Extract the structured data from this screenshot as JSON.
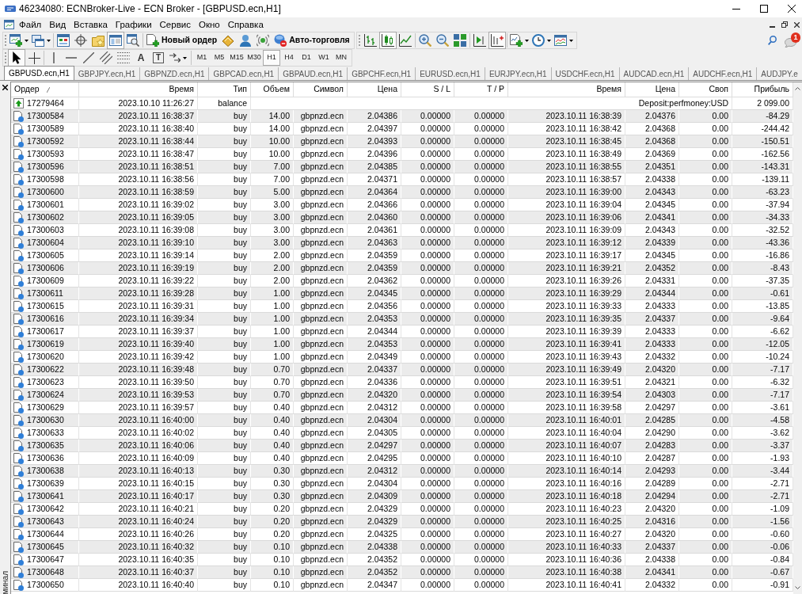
{
  "window": {
    "title": "46234080: ECNBroker-Live - ECN Broker - [GBPUSD.ecn,H1]"
  },
  "menu": [
    "Файл",
    "Вид",
    "Вставка",
    "Графики",
    "Сервис",
    "Окно",
    "Справка"
  ],
  "main_toolbar": [
    [
      [
        {
          "kind": "menu",
          "pressed": false
        },
        {
          "kind": "menu",
          "pressed": false
        }
      ],
      [
        {
          "kind": "icon",
          "pressed": false
        },
        {
          "kind": "icon",
          "pressed": false
        },
        {
          "kind": "icon",
          "pressed": false
        },
        {
          "kind": "icon",
          "pressed": true
        },
        {
          "kind": "icon",
          "pressed": false
        }
      ],
      [
        {
          "kind": "labeled",
          "label": "Новый ордер",
          "pressed": false
        },
        {
          "kind": "icon",
          "pressed": false
        },
        {
          "kind": "icon",
          "pressed": false
        },
        {
          "kind": "icon",
          "pressed": false
        },
        {
          "kind": "labeled",
          "label": "Авто-торговля",
          "pressed": false
        }
      ]
    ],
    [
      [
        {
          "kind": "icon",
          "pressed": false
        },
        {
          "kind": "icon",
          "pressed": true
        },
        {
          "kind": "icon",
          "pressed": false
        }
      ],
      [
        {
          "kind": "icon",
          "pressed": false
        },
        {
          "kind": "icon",
          "pressed": false
        },
        {
          "kind": "icon",
          "pressed": false
        }
      ],
      [
        {
          "kind": "icon",
          "pressed": false
        },
        {
          "kind": "icon",
          "pressed": true
        }
      ],
      [
        {
          "kind": "menu",
          "pressed": false
        },
        {
          "kind": "menu",
          "pressed": false
        },
        {
          "kind": "menu",
          "pressed": false
        }
      ]
    ]
  ],
  "notifications": {
    "count": "1"
  },
  "drawing_toolbar": [
    [
      {
        "kind": "icon",
        "pressed": true
      },
      {
        "kind": "icon",
        "pressed": false
      }
    ],
    [
      {
        "kind": "icon",
        "pressed": false
      },
      {
        "kind": "icon",
        "pressed": false
      },
      {
        "kind": "icon",
        "pressed": false
      },
      {
        "kind": "icon",
        "pressed": false
      },
      {
        "kind": "icon",
        "pressed": false
      },
      {
        "kind": "glyph",
        "glyph": "A",
        "pressed": false
      },
      {
        "kind": "framed_glyph",
        "glyph": "T",
        "pressed": false
      },
      {
        "kind": "menu",
        "pressed": false
      }
    ]
  ],
  "timeframes": [
    {
      "label": "M1",
      "selected": false
    },
    {
      "label": "M5",
      "selected": false
    },
    {
      "label": "M15",
      "selected": false
    },
    {
      "label": "M30",
      "selected": false
    },
    {
      "label": "H1",
      "selected": true
    },
    {
      "label": "H4",
      "selected": false
    },
    {
      "label": "D1",
      "selected": false
    },
    {
      "label": "W1",
      "selected": false
    },
    {
      "label": "MN",
      "selected": false
    }
  ],
  "chart_tabs": [
    {
      "label": "GBPUSD.ecn,H1",
      "selected": true
    },
    {
      "label": "GBPJPY.ecn,H1",
      "selected": false
    },
    {
      "label": "GBPNZD.ecn,H1",
      "selected": false
    },
    {
      "label": "GBPCAD.ecn,H1",
      "selected": false
    },
    {
      "label": "GBPAUD.ecn,H1",
      "selected": false
    },
    {
      "label": "GBPCHF.ecn,H1",
      "selected": false
    },
    {
      "label": "EURUSD.ecn,H1",
      "selected": false
    },
    {
      "label": "EURJPY.ecn,H1",
      "selected": false
    },
    {
      "label": "USDCHF.ecn,H1",
      "selected": false
    },
    {
      "label": "AUDCAD.ecn,H1",
      "selected": false
    },
    {
      "label": "AUDCHF.ecn,H1",
      "selected": false
    },
    {
      "label": "AUDJPY.e",
      "selected": false
    }
  ],
  "terminal": {
    "side_label": "минал",
    "columns": [
      {
        "label": "Ордер",
        "sorted": true
      },
      {
        "label": "Время",
        "sorted": false
      },
      {
        "label": "Тип",
        "sorted": false
      },
      {
        "label": "Объем",
        "sorted": false
      },
      {
        "label": "Символ",
        "sorted": false
      },
      {
        "label": "Цена",
        "sorted": false
      },
      {
        "label": "S / L",
        "sorted": false
      },
      {
        "label": "T / P",
        "sorted": false
      },
      {
        "label": "Время",
        "sorted": false
      },
      {
        "label": "Цена",
        "sorted": false
      },
      {
        "label": "Своп",
        "sorted": false
      },
      {
        "label": "Прибыль",
        "sorted": false
      }
    ],
    "rows": [
      {
        "kind": "balance",
        "cells": [
          "17279464",
          "2023.10.10 11:26:27",
          "balance",
          "",
          "",
          "",
          "",
          "",
          "",
          "Deposit:perfmoney:USD",
          "",
          "2 099.00"
        ]
      },
      {
        "kind": "trade",
        "cells": [
          "17300584",
          "2023.10.11 16:38:37",
          "buy",
          "14.00",
          "gbpnzd.ecn",
          "2.04386",
          "0.00000",
          "0.00000",
          "2023.10.11 16:38:39",
          "2.04376",
          "0.00",
          "-84.29"
        ]
      },
      {
        "kind": "trade",
        "cells": [
          "17300589",
          "2023.10.11 16:38:40",
          "buy",
          "14.00",
          "gbpnzd.ecn",
          "2.04397",
          "0.00000",
          "0.00000",
          "2023.10.11 16:38:42",
          "2.04368",
          "0.00",
          "-244.42"
        ]
      },
      {
        "kind": "trade",
        "cells": [
          "17300592",
          "2023.10.11 16:38:44",
          "buy",
          "10.00",
          "gbpnzd.ecn",
          "2.04393",
          "0.00000",
          "0.00000",
          "2023.10.11 16:38:45",
          "2.04368",
          "0.00",
          "-150.51"
        ]
      },
      {
        "kind": "trade",
        "cells": [
          "17300593",
          "2023.10.11 16:38:47",
          "buy",
          "10.00",
          "gbpnzd.ecn",
          "2.04396",
          "0.00000",
          "0.00000",
          "2023.10.11 16:38:49",
          "2.04369",
          "0.00",
          "-162.56"
        ]
      },
      {
        "kind": "trade",
        "cells": [
          "17300596",
          "2023.10.11 16:38:51",
          "buy",
          "7.00",
          "gbpnzd.ecn",
          "2.04385",
          "0.00000",
          "0.00000",
          "2023.10.11 16:38:55",
          "2.04351",
          "0.00",
          "-143.31"
        ]
      },
      {
        "kind": "trade",
        "cells": [
          "17300598",
          "2023.10.11 16:38:56",
          "buy",
          "7.00",
          "gbpnzd.ecn",
          "2.04371",
          "0.00000",
          "0.00000",
          "2023.10.11 16:38:57",
          "2.04338",
          "0.00",
          "-139.11"
        ]
      },
      {
        "kind": "trade",
        "cells": [
          "17300600",
          "2023.10.11 16:38:59",
          "buy",
          "5.00",
          "gbpnzd.ecn",
          "2.04364",
          "0.00000",
          "0.00000",
          "2023.10.11 16:39:00",
          "2.04343",
          "0.00",
          "-63.23"
        ]
      },
      {
        "kind": "trade",
        "cells": [
          "17300601",
          "2023.10.11 16:39:02",
          "buy",
          "3.00",
          "gbpnzd.ecn",
          "2.04366",
          "0.00000",
          "0.00000",
          "2023.10.11 16:39:04",
          "2.04345",
          "0.00",
          "-37.94"
        ]
      },
      {
        "kind": "trade",
        "cells": [
          "17300602",
          "2023.10.11 16:39:05",
          "buy",
          "3.00",
          "gbpnzd.ecn",
          "2.04360",
          "0.00000",
          "0.00000",
          "2023.10.11 16:39:06",
          "2.04341",
          "0.00",
          "-34.33"
        ]
      },
      {
        "kind": "trade",
        "cells": [
          "17300603",
          "2023.10.11 16:39:08",
          "buy",
          "3.00",
          "gbpnzd.ecn",
          "2.04361",
          "0.00000",
          "0.00000",
          "2023.10.11 16:39:09",
          "2.04343",
          "0.00",
          "-32.52"
        ]
      },
      {
        "kind": "trade",
        "cells": [
          "17300604",
          "2023.10.11 16:39:10",
          "buy",
          "3.00",
          "gbpnzd.ecn",
          "2.04363",
          "0.00000",
          "0.00000",
          "2023.10.11 16:39:12",
          "2.04339",
          "0.00",
          "-43.36"
        ]
      },
      {
        "kind": "trade",
        "cells": [
          "17300605",
          "2023.10.11 16:39:14",
          "buy",
          "2.00",
          "gbpnzd.ecn",
          "2.04359",
          "0.00000",
          "0.00000",
          "2023.10.11 16:39:17",
          "2.04345",
          "0.00",
          "-16.86"
        ]
      },
      {
        "kind": "trade",
        "cells": [
          "17300606",
          "2023.10.11 16:39:19",
          "buy",
          "2.00",
          "gbpnzd.ecn",
          "2.04359",
          "0.00000",
          "0.00000",
          "2023.10.11 16:39:21",
          "2.04352",
          "0.00",
          "-8.43"
        ]
      },
      {
        "kind": "trade",
        "cells": [
          "17300609",
          "2023.10.11 16:39:22",
          "buy",
          "2.00",
          "gbpnzd.ecn",
          "2.04362",
          "0.00000",
          "0.00000",
          "2023.10.11 16:39:26",
          "2.04331",
          "0.00",
          "-37.35"
        ]
      },
      {
        "kind": "trade",
        "cells": [
          "17300611",
          "2023.10.11 16:39:28",
          "buy",
          "1.00",
          "gbpnzd.ecn",
          "2.04345",
          "0.00000",
          "0.00000",
          "2023.10.11 16:39:29",
          "2.04344",
          "0.00",
          "-0.61"
        ]
      },
      {
        "kind": "trade",
        "cells": [
          "17300615",
          "2023.10.11 16:39:31",
          "buy",
          "1.00",
          "gbpnzd.ecn",
          "2.04356",
          "0.00000",
          "0.00000",
          "2023.10.11 16:39:33",
          "2.04333",
          "0.00",
          "-13.85"
        ]
      },
      {
        "kind": "trade",
        "cells": [
          "17300616",
          "2023.10.11 16:39:34",
          "buy",
          "1.00",
          "gbpnzd.ecn",
          "2.04353",
          "0.00000",
          "0.00000",
          "2023.10.11 16:39:35",
          "2.04337",
          "0.00",
          "-9.64"
        ]
      },
      {
        "kind": "trade",
        "cells": [
          "17300617",
          "2023.10.11 16:39:37",
          "buy",
          "1.00",
          "gbpnzd.ecn",
          "2.04344",
          "0.00000",
          "0.00000",
          "2023.10.11 16:39:39",
          "2.04333",
          "0.00",
          "-6.62"
        ]
      },
      {
        "kind": "trade",
        "cells": [
          "17300619",
          "2023.10.11 16:39:40",
          "buy",
          "1.00",
          "gbpnzd.ecn",
          "2.04353",
          "0.00000",
          "0.00000",
          "2023.10.11 16:39:41",
          "2.04333",
          "0.00",
          "-12.05"
        ]
      },
      {
        "kind": "trade",
        "cells": [
          "17300620",
          "2023.10.11 16:39:42",
          "buy",
          "1.00",
          "gbpnzd.ecn",
          "2.04349",
          "0.00000",
          "0.00000",
          "2023.10.11 16:39:43",
          "2.04332",
          "0.00",
          "-10.24"
        ]
      },
      {
        "kind": "trade",
        "cells": [
          "17300622",
          "2023.10.11 16:39:48",
          "buy",
          "0.70",
          "gbpnzd.ecn",
          "2.04337",
          "0.00000",
          "0.00000",
          "2023.10.11 16:39:49",
          "2.04320",
          "0.00",
          "-7.17"
        ]
      },
      {
        "kind": "trade",
        "cells": [
          "17300623",
          "2023.10.11 16:39:50",
          "buy",
          "0.70",
          "gbpnzd.ecn",
          "2.04336",
          "0.00000",
          "0.00000",
          "2023.10.11 16:39:51",
          "2.04321",
          "0.00",
          "-6.32"
        ]
      },
      {
        "kind": "trade",
        "cells": [
          "17300624",
          "2023.10.11 16:39:53",
          "buy",
          "0.70",
          "gbpnzd.ecn",
          "2.04320",
          "0.00000",
          "0.00000",
          "2023.10.11 16:39:54",
          "2.04303",
          "0.00",
          "-7.17"
        ]
      },
      {
        "kind": "trade",
        "cells": [
          "17300629",
          "2023.10.11 16:39:57",
          "buy",
          "0.40",
          "gbpnzd.ecn",
          "2.04312",
          "0.00000",
          "0.00000",
          "2023.10.11 16:39:58",
          "2.04297",
          "0.00",
          "-3.61"
        ]
      },
      {
        "kind": "trade",
        "cells": [
          "17300630",
          "2023.10.11 16:40:00",
          "buy",
          "0.40",
          "gbpnzd.ecn",
          "2.04304",
          "0.00000",
          "0.00000",
          "2023.10.11 16:40:01",
          "2.04285",
          "0.00",
          "-4.58"
        ]
      },
      {
        "kind": "trade",
        "cells": [
          "17300633",
          "2023.10.11 16:40:02",
          "buy",
          "0.40",
          "gbpnzd.ecn",
          "2.04305",
          "0.00000",
          "0.00000",
          "2023.10.11 16:40:04",
          "2.04290",
          "0.00",
          "-3.62"
        ]
      },
      {
        "kind": "trade",
        "cells": [
          "17300635",
          "2023.10.11 16:40:06",
          "buy",
          "0.40",
          "gbpnzd.ecn",
          "2.04297",
          "0.00000",
          "0.00000",
          "2023.10.11 16:40:07",
          "2.04283",
          "0.00",
          "-3.37"
        ]
      },
      {
        "kind": "trade",
        "cells": [
          "17300636",
          "2023.10.11 16:40:09",
          "buy",
          "0.40",
          "gbpnzd.ecn",
          "2.04295",
          "0.00000",
          "0.00000",
          "2023.10.11 16:40:10",
          "2.04287",
          "0.00",
          "-1.93"
        ]
      },
      {
        "kind": "trade",
        "cells": [
          "17300638",
          "2023.10.11 16:40:13",
          "buy",
          "0.30",
          "gbpnzd.ecn",
          "2.04312",
          "0.00000",
          "0.00000",
          "2023.10.11 16:40:14",
          "2.04293",
          "0.00",
          "-3.44"
        ]
      },
      {
        "kind": "trade",
        "cells": [
          "17300639",
          "2023.10.11 16:40:15",
          "buy",
          "0.30",
          "gbpnzd.ecn",
          "2.04304",
          "0.00000",
          "0.00000",
          "2023.10.11 16:40:16",
          "2.04289",
          "0.00",
          "-2.71"
        ]
      },
      {
        "kind": "trade",
        "cells": [
          "17300641",
          "2023.10.11 16:40:17",
          "buy",
          "0.30",
          "gbpnzd.ecn",
          "2.04309",
          "0.00000",
          "0.00000",
          "2023.10.11 16:40:18",
          "2.04294",
          "0.00",
          "-2.71"
        ]
      },
      {
        "kind": "trade",
        "cells": [
          "17300642",
          "2023.10.11 16:40:21",
          "buy",
          "0.20",
          "gbpnzd.ecn",
          "2.04329",
          "0.00000",
          "0.00000",
          "2023.10.11 16:40:23",
          "2.04320",
          "0.00",
          "-1.09"
        ]
      },
      {
        "kind": "trade",
        "cells": [
          "17300643",
          "2023.10.11 16:40:24",
          "buy",
          "0.20",
          "gbpnzd.ecn",
          "2.04329",
          "0.00000",
          "0.00000",
          "2023.10.11 16:40:25",
          "2.04316",
          "0.00",
          "-1.56"
        ]
      },
      {
        "kind": "trade",
        "cells": [
          "17300644",
          "2023.10.11 16:40:26",
          "buy",
          "0.20",
          "gbpnzd.ecn",
          "2.04325",
          "0.00000",
          "0.00000",
          "2023.10.11 16:40:27",
          "2.04320",
          "0.00",
          "-0.60"
        ]
      },
      {
        "kind": "trade",
        "cells": [
          "17300645",
          "2023.10.11 16:40:32",
          "buy",
          "0.10",
          "gbpnzd.ecn",
          "2.04338",
          "0.00000",
          "0.00000",
          "2023.10.11 16:40:33",
          "2.04337",
          "0.00",
          "-0.06"
        ]
      },
      {
        "kind": "trade",
        "cells": [
          "17300647",
          "2023.10.11 16:40:35",
          "buy",
          "0.10",
          "gbpnzd.ecn",
          "2.04352",
          "0.00000",
          "0.00000",
          "2023.10.11 16:40:36",
          "2.04338",
          "0.00",
          "-0.84"
        ]
      },
      {
        "kind": "trade",
        "cells": [
          "17300648",
          "2023.10.11 16:40:37",
          "buy",
          "0.10",
          "gbpnzd.ecn",
          "2.04352",
          "0.00000",
          "0.00000",
          "2023.10.11 16:40:38",
          "2.04341",
          "0.00",
          "-0.67"
        ]
      },
      {
        "kind": "trade",
        "cells": [
          "17300650",
          "2023.10.11 16:40:40",
          "buy",
          "0.10",
          "gbpnzd.ecn",
          "2.04347",
          "0.00000",
          "0.00000",
          "2023.10.11 16:40:41",
          "2.04332",
          "0.00",
          "-0.91"
        ]
      }
    ]
  }
}
